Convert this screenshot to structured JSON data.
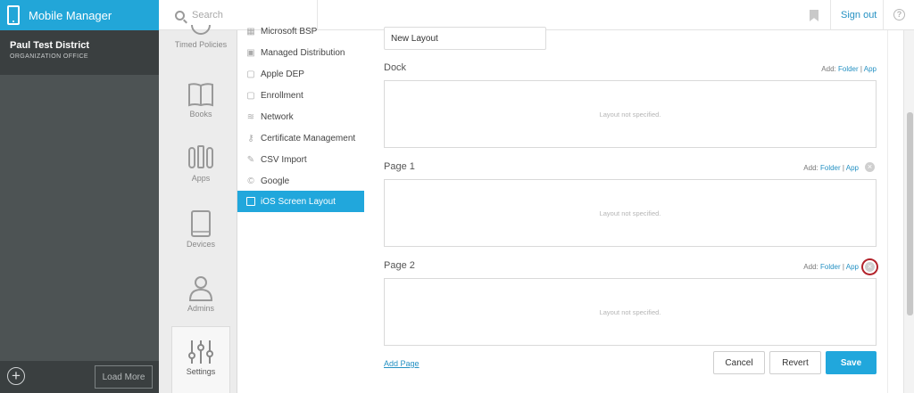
{
  "app": {
    "title": "Mobile Manager"
  },
  "organization": {
    "name": "Paul Test District",
    "subtitle": "ORGANIZATION OFFICE"
  },
  "left_bottom": {
    "load_more_label": "Load More"
  },
  "topbar": {
    "search_placeholder": "Search",
    "sign_out_label": "Sign out"
  },
  "icon_nav": [
    {
      "label": "Timed Policies",
      "icon": "timed-policies-icon"
    },
    {
      "label": "Books",
      "icon": "book-icon"
    },
    {
      "label": "Apps",
      "icon": "apps-icon"
    },
    {
      "label": "Devices",
      "icon": "tablet-icon"
    },
    {
      "label": "Admins",
      "icon": "user-icon"
    },
    {
      "label": "Settings",
      "icon": "sliders-icon",
      "active": true
    }
  ],
  "submenu": [
    {
      "label": "Microsoft BSP",
      "icon": "windows-icon"
    },
    {
      "label": "Managed Distribution",
      "icon": "stack-icon"
    },
    {
      "label": "Apple DEP",
      "icon": "square-icon"
    },
    {
      "label": "Enrollment",
      "icon": "square-icon"
    },
    {
      "label": "Network",
      "icon": "wifi-icon"
    },
    {
      "label": "Certificate Management",
      "icon": "key-icon"
    },
    {
      "label": "CSV Import",
      "icon": "edit-icon"
    },
    {
      "label": "Google",
      "icon": "google-icon"
    },
    {
      "label": "iOS Screen Layout",
      "icon": "square-icon",
      "active": true
    }
  ],
  "layout": {
    "name_value": "New Layout",
    "add_prefix": "Add:",
    "folder_label": "Folder",
    "separator": "|",
    "app_label": "App",
    "empty_text": "Layout not specified.",
    "sections": [
      {
        "title": "Dock"
      },
      {
        "title": "Page 1"
      },
      {
        "title": "Page 2"
      }
    ],
    "add_page_label": "Add Page"
  },
  "actions": {
    "cancel": "Cancel",
    "revert": "Revert",
    "save": "Save"
  },
  "colors": {
    "accent": "#21a7dc",
    "sidebar": "#4d5354",
    "link": "#2591c3",
    "highlight_ring": "#b3232b"
  }
}
